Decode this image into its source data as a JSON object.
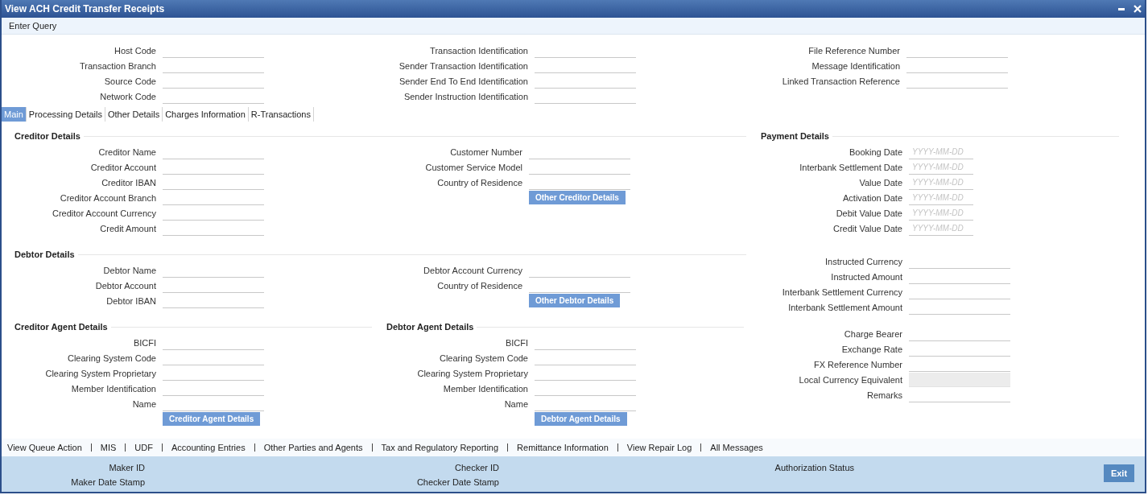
{
  "window": {
    "title": "View ACH Credit Transfer Receipts"
  },
  "toolbar": {
    "actions": [
      "Enter Query"
    ]
  },
  "header": {
    "columns": [
      {
        "fields": [
          "Host Code",
          "Transaction Branch",
          "Source Code",
          "Network Code"
        ]
      },
      {
        "fields": [
          "Transaction Identification",
          "Sender Transaction Identification",
          "Sender End To End Identification",
          "Sender Instruction Identification"
        ]
      },
      {
        "fields": [
          "File Reference Number",
          "Message Identification",
          "Linked Transaction Reference"
        ]
      }
    ]
  },
  "tabs": [
    {
      "label": "Main",
      "selected": true
    },
    {
      "label": "Processing Details",
      "selected": false
    },
    {
      "label": "Other Details",
      "selected": false
    },
    {
      "label": "Charges Information",
      "selected": false
    },
    {
      "label": "R-Transactions",
      "selected": false
    }
  ],
  "creditor_details": {
    "title": "Creditor Details",
    "left_fields": [
      "Creditor Name",
      "Creditor Account",
      "Creditor IBAN",
      "Creditor Account Branch",
      "Creditor Account Currency",
      "Credit Amount"
    ],
    "right_fields": [
      "Customer Number",
      "Customer Service Model",
      "Country of Residence"
    ],
    "button": "Other Creditor Details"
  },
  "debtor_details": {
    "title": "Debtor Details",
    "left_fields": [
      "Debtor Name",
      "Debtor Account",
      "Debtor IBAN"
    ],
    "right_fields": [
      "Debtor Account Currency",
      "Country of Residence"
    ],
    "button": "Other Debtor Details"
  },
  "creditor_agent_details": {
    "title": "Creditor Agent Details",
    "fields": [
      "BICFI",
      "Clearing System Code",
      "Clearing System Proprietary",
      "Member Identification",
      "Name"
    ],
    "button": "Creditor Agent Details"
  },
  "debtor_agent_details": {
    "title": "Debtor Agent Details",
    "fields": [
      "BICFI",
      "Clearing System Code",
      "Clearing System Proprietary",
      "Member Identification",
      "Name"
    ],
    "button": "Debtor Agent Details"
  },
  "payment_details": {
    "title": "Payment Details",
    "dates": [
      {
        "label": "Booking Date",
        "placeholder": "YYYY-MM-DD"
      },
      {
        "label": "Interbank Settlement Date",
        "placeholder": "YYYY-MM-DD"
      },
      {
        "label": "Value Date",
        "placeholder": "YYYY-MM-DD"
      },
      {
        "label": "Activation Date",
        "placeholder": "YYYY-MM-DD"
      },
      {
        "label": "Debit Value Date",
        "placeholder": "YYYY-MM-DD"
      },
      {
        "label": "Credit Value Date",
        "placeholder": "YYYY-MM-DD"
      }
    ],
    "amounts": [
      "Instructed Currency",
      "Instructed Amount",
      "Interbank Settlement Currency",
      "Interbank Settlement Amount"
    ],
    "charges": [
      {
        "label": "Charge Bearer",
        "disabled": false
      },
      {
        "label": "Exchange Rate",
        "disabled": false
      },
      {
        "label": "FX Reference Number",
        "disabled": false
      },
      {
        "label": "Local Currency Equivalent",
        "disabled": true
      },
      {
        "label": "Remarks",
        "disabled": false
      }
    ]
  },
  "footer_links": [
    "View Queue Action",
    "MIS",
    "UDF",
    "Accounting Entries",
    "Other Parties and Agents",
    "Tax and Regulatory Reporting",
    "Remittance Information",
    "View Repair Log",
    "All Messages"
  ],
  "audit": {
    "columns": [
      {
        "labels": [
          "Maker ID",
          "Maker Date Stamp"
        ]
      },
      {
        "labels": [
          "Checker ID",
          "Checker Date Stamp"
        ]
      },
      {
        "labels": [
          "Authorization Status"
        ]
      }
    ]
  },
  "exit_button": "Exit"
}
